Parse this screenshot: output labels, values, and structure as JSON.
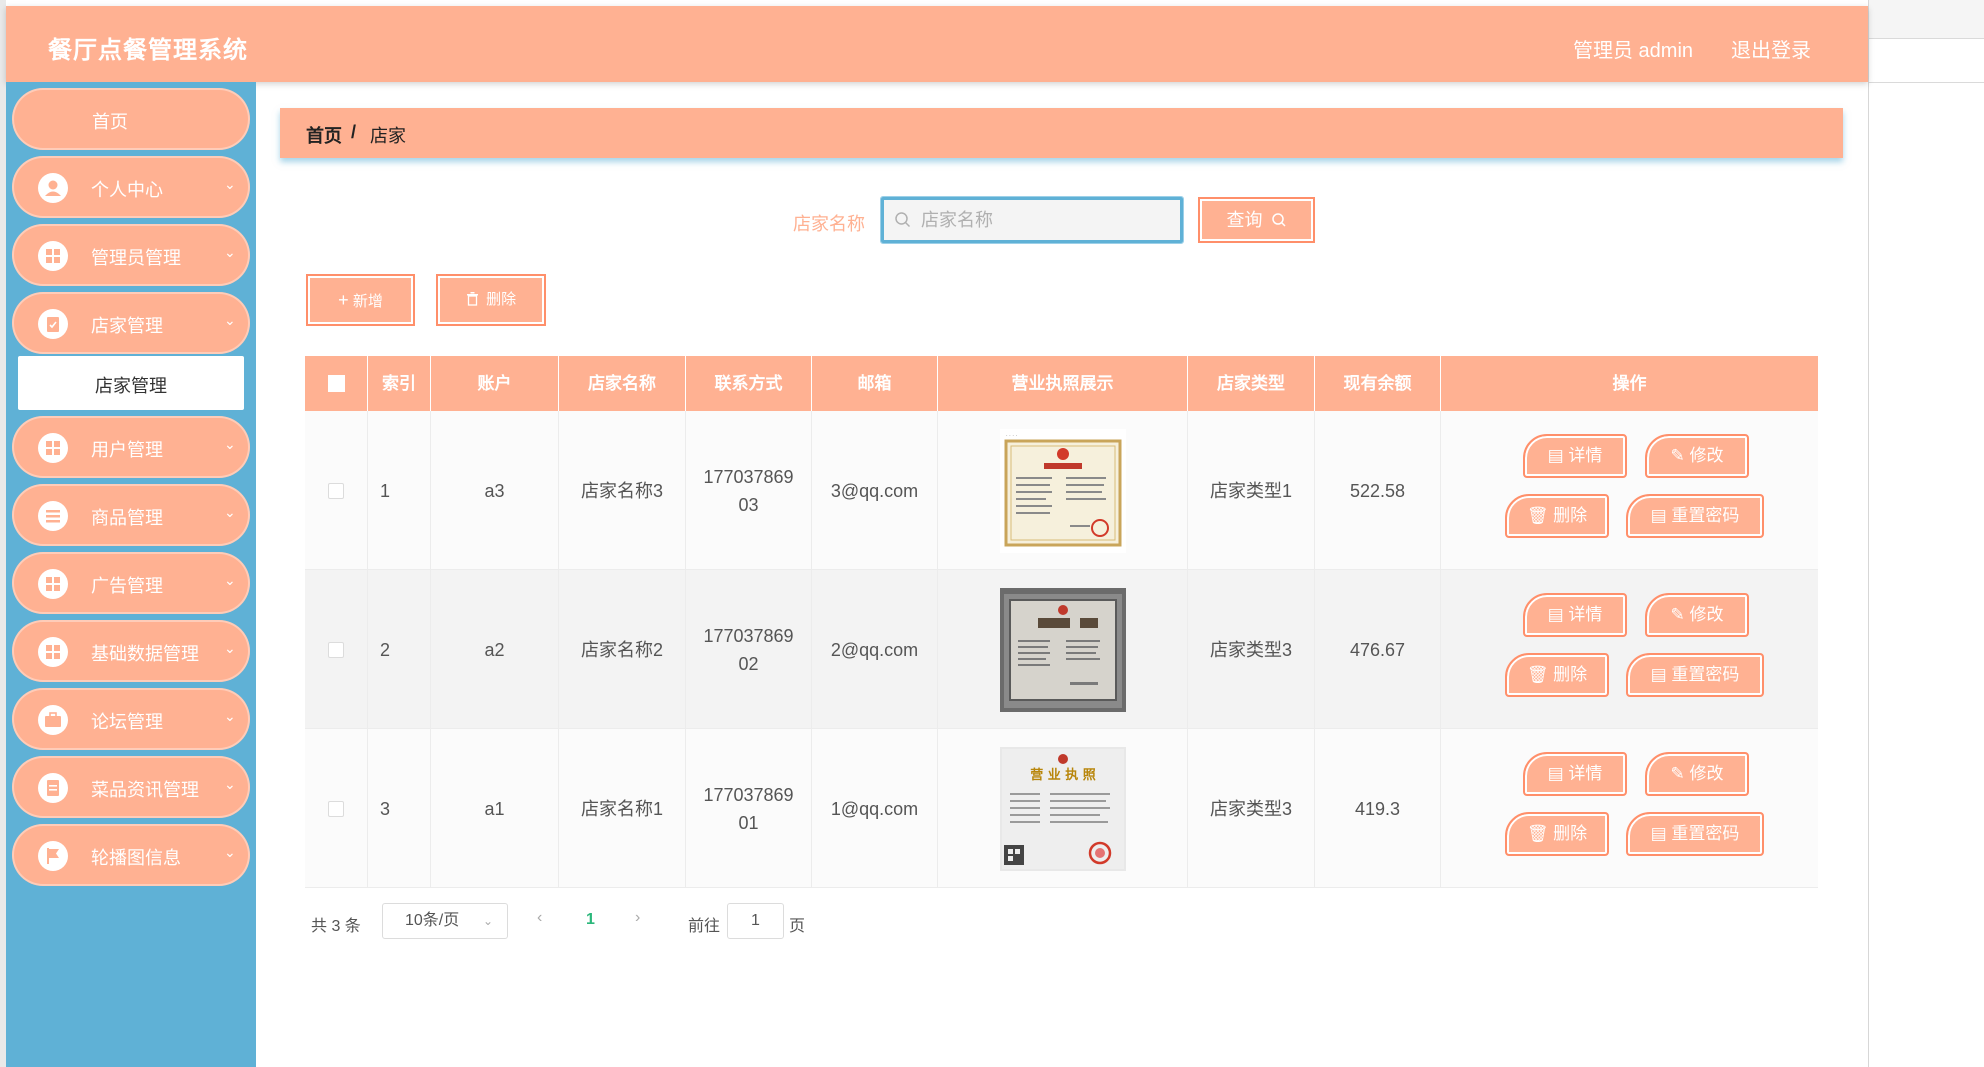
{
  "header": {
    "title": "餐厅点餐管理系统",
    "user": "管理员 admin",
    "logout": "退出登录"
  },
  "sidebar": {
    "items": [
      {
        "label": "首页",
        "icon": "home"
      },
      {
        "label": "个人中心",
        "icon": "user-icon"
      },
      {
        "label": "管理员管理",
        "icon": "grid-icon"
      },
      {
        "label": "店家管理",
        "icon": "clipboard-icon"
      },
      {
        "label": "用户管理",
        "icon": "grid-icon"
      },
      {
        "label": "商品管理",
        "icon": "list-icon"
      },
      {
        "label": "广告管理",
        "icon": "grid-icon"
      },
      {
        "label": "基础数据管理",
        "icon": "grid-icon"
      },
      {
        "label": "论坛管理",
        "icon": "briefcase-icon"
      },
      {
        "label": "菜品资讯管理",
        "icon": "document-icon"
      },
      {
        "label": "轮播图信息",
        "icon": "flag-icon"
      }
    ],
    "submenu_active": "店家管理"
  },
  "breadcrumb": {
    "home": "首页",
    "separator": "/",
    "current": "店家"
  },
  "search": {
    "label": "店家名称",
    "placeholder": "店家名称",
    "button": "查询"
  },
  "actions": {
    "add": "新增",
    "delete": "删除"
  },
  "table": {
    "headers": [
      "索引",
      "账户",
      "店家名称",
      "联系方式",
      "邮箱",
      "营业执照展示",
      "店家类型",
      "现有余额",
      "操作"
    ],
    "rows": [
      {
        "index": "1",
        "account": "a3",
        "name": "店家名称3",
        "phone_a": "177037869",
        "phone_b": "03",
        "email": "3@qq.com",
        "type": "店家类型1",
        "balance": "522.58"
      },
      {
        "index": "2",
        "account": "a2",
        "name": "店家名称2",
        "phone_a": "177037869",
        "phone_b": "02",
        "email": "2@qq.com",
        "type": "店家类型3",
        "balance": "476.67"
      },
      {
        "index": "3",
        "account": "a1",
        "name": "店家名称1",
        "phone_a": "177037869",
        "phone_b": "01",
        "email": "1@qq.com",
        "type": "店家类型3",
        "balance": "419.3"
      }
    ],
    "row_buttons": {
      "detail": "详情",
      "edit": "修改",
      "delete": "删除",
      "reset": "重置密码"
    },
    "license_title": "营 业 执 照"
  },
  "pagination": {
    "total": "共 3 条",
    "page_size": "10条/页",
    "current": "1",
    "goto": "前往",
    "goto_value": "1",
    "page_suffix": "页"
  },
  "colors": {
    "accent": "#ffb192",
    "sidebar": "#5fb1d6",
    "active_page": "#2bb77b"
  }
}
